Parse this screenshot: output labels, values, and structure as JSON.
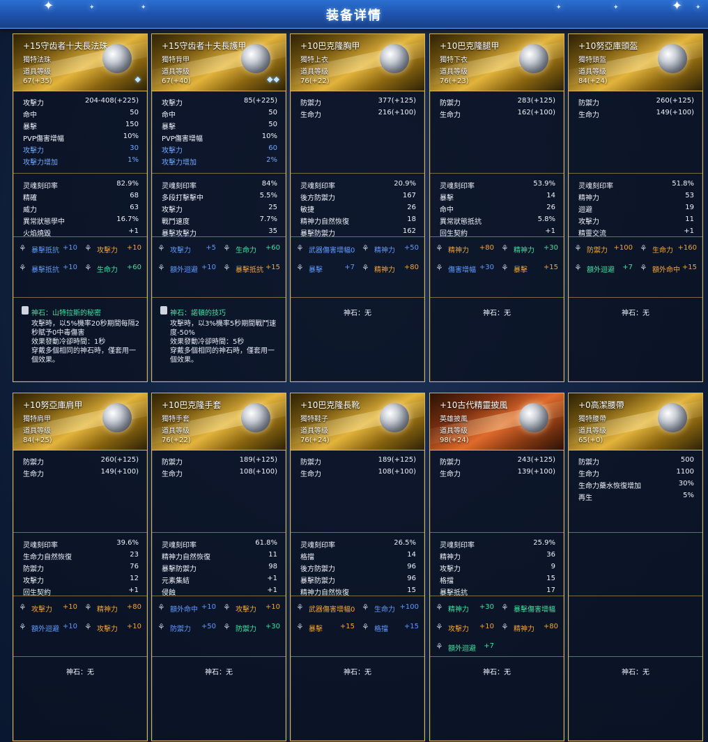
{
  "window": {
    "title": "装备详情"
  },
  "colors": {
    "accent": "#d6b45a",
    "blue": "#5e9bff",
    "orange": "#f5a434",
    "green": "#3fe0a0"
  },
  "items": [
    {
      "name": "+15守齿者十夫長法珠",
      "type": "獨特法珠",
      "level_label": "道具等级",
      "level": "67(+35)",
      "gems": "◆",
      "base": [
        {
          "k": "攻擊力",
          "v": "204-408(+225)",
          "c": ""
        },
        {
          "k": "命中",
          "v": "50",
          "c": ""
        },
        {
          "k": "暴擊",
          "v": "150",
          "c": ""
        },
        {
          "k": "PVP傷害增幅",
          "v": "10%",
          "c": ""
        },
        {
          "k": "攻擊力",
          "v": "30",
          "c": "blue"
        },
        {
          "k": "攻擊力增加",
          "v": "1%",
          "c": "blue"
        }
      ],
      "secondary": [
        {
          "k": "灵魂刻印率",
          "v": "82.9%"
        },
        {
          "k": "精確",
          "v": "68"
        },
        {
          "k": "威力",
          "v": "63"
        },
        {
          "k": "異常狀態學中",
          "v": "16.7%"
        },
        {
          "k": "火焰燒毀",
          "v": "+1"
        }
      ],
      "bonuses": [
        {
          "k": "暴擊抵抗",
          "v": "+10",
          "c": "blue"
        },
        {
          "k": "攻擊力",
          "v": "+10",
          "c": "orange"
        },
        {
          "k": "暴擊抵抗",
          "v": "+10",
          "c": "blue"
        },
        {
          "k": "生命力",
          "v": "+60",
          "c": "green"
        }
      ],
      "stone": "神石：山特拉斯的秘密",
      "stone_desc": "攻擊時，以5%機率20秒期間每隔2秒賦予0中毒傷害\n效果發動冷卻時間：1秒\n穿戴多個相同的神石時，僅套用一個效果。"
    },
    {
      "name": "+15守齿者十夫長護甲",
      "type": "獨特背甲",
      "level_label": "道具等级",
      "level": "67(+40)",
      "gems": "◆◆",
      "base": [
        {
          "k": "攻擊力",
          "v": "85(+225)",
          "c": ""
        },
        {
          "k": "命中",
          "v": "50",
          "c": ""
        },
        {
          "k": "暴擊",
          "v": "50",
          "c": ""
        },
        {
          "k": "PVP傷害增幅",
          "v": "10%",
          "c": ""
        },
        {
          "k": "攻擊力",
          "v": "60",
          "c": "blue"
        },
        {
          "k": "攻擊力增加",
          "v": "2%",
          "c": "blue"
        }
      ],
      "secondary": [
        {
          "k": "灵魂刻印率",
          "v": "84%"
        },
        {
          "k": "多段打擊擊中",
          "v": "5.5%"
        },
        {
          "k": "攻擊力",
          "v": "25"
        },
        {
          "k": "戰鬥速度",
          "v": "7.7%"
        },
        {
          "k": "暴擊攻擊力",
          "v": "35"
        }
      ],
      "bonuses": [
        {
          "k": "攻擊力",
          "v": "+5",
          "c": "blue"
        },
        {
          "k": "生命力",
          "v": "+60",
          "c": "green"
        },
        {
          "k": "額外迴避",
          "v": "+10",
          "c": "blue"
        },
        {
          "k": "暴擊抵抗",
          "v": "+15",
          "c": "orange"
        }
      ],
      "stone": "神石：諾頓的技巧",
      "stone_desc": "攻擊時，以3%機率5秒期間戰鬥速度-50%\n效果發動冷卻時間：5秒\n穿戴多個相同的神石時，僅套用一個效果。"
    },
    {
      "name": "+10巴克隆胸甲",
      "type": "獨特上衣",
      "level_label": "道具等级",
      "level": "76(+22)",
      "gems": "",
      "base": [
        {
          "k": "防禦力",
          "v": "377(+125)",
          "c": ""
        },
        {
          "k": "生命力",
          "v": "216(+100)",
          "c": ""
        }
      ],
      "secondary": [
        {
          "k": "灵魂刻印率",
          "v": "20.9%"
        },
        {
          "k": "後方防禦力",
          "v": "167"
        },
        {
          "k": "敏捷",
          "v": "26"
        },
        {
          "k": "精神力自然恢復",
          "v": "18"
        },
        {
          "k": "暴擊防禦力",
          "v": "162"
        }
      ],
      "bonuses": [
        {
          "k": "武器傷害增幅0",
          "v": "",
          "c": "blue"
        },
        {
          "k": "精神力",
          "v": "+50",
          "c": "blue"
        },
        {
          "k": "暴擊",
          "v": "+7",
          "c": "blue"
        },
        {
          "k": "精神力",
          "v": "+80",
          "c": "orange"
        }
      ],
      "stone": "神石：无",
      "stone_desc": ""
    },
    {
      "name": "+10巴克隆腿甲",
      "type": "獨特下衣",
      "level_label": "道具等级",
      "level": "76(+23)",
      "gems": "",
      "base": [
        {
          "k": "防禦力",
          "v": "283(+125)",
          "c": ""
        },
        {
          "k": "生命力",
          "v": "162(+100)",
          "c": ""
        }
      ],
      "secondary": [
        {
          "k": "灵魂刻印率",
          "v": "53.9%"
        },
        {
          "k": "暴擊",
          "v": "14"
        },
        {
          "k": "命中",
          "v": "26"
        },
        {
          "k": "異常狀態抵抗",
          "v": "5.8%"
        },
        {
          "k": "回生契約",
          "v": "+1"
        }
      ],
      "bonuses": [
        {
          "k": "精神力",
          "v": "+80",
          "c": "orange"
        },
        {
          "k": "精神力",
          "v": "+30",
          "c": "green"
        },
        {
          "k": "傷害增幅",
          "v": "+30",
          "c": "blue"
        },
        {
          "k": "暴擊",
          "v": "+15",
          "c": "orange"
        }
      ],
      "stone": "神石：无",
      "stone_desc": ""
    },
    {
      "name": "+10努亞庫頭盔",
      "type": "獨特頭盔",
      "level_label": "道具等级",
      "level": "84(+24)",
      "gems": "",
      "base": [
        {
          "k": "防禦力",
          "v": "260(+125)",
          "c": ""
        },
        {
          "k": "生命力",
          "v": "149(+100)",
          "c": ""
        }
      ],
      "secondary": [
        {
          "k": "灵魂刻印率",
          "v": "51.8%"
        },
        {
          "k": "精神力",
          "v": "53"
        },
        {
          "k": "迴避",
          "v": "19"
        },
        {
          "k": "攻擊力",
          "v": "11"
        },
        {
          "k": "精靈交流",
          "v": "+1"
        }
      ],
      "bonuses": [
        {
          "k": "防禦力",
          "v": "+100",
          "c": "orange"
        },
        {
          "k": "生命力",
          "v": "+160",
          "c": "orange"
        },
        {
          "k": "額外迴避",
          "v": "+7",
          "c": "green"
        },
        {
          "k": "額外命中",
          "v": "+15",
          "c": "orange"
        }
      ],
      "stone": "神石：无",
      "stone_desc": ""
    },
    {
      "name": "+10努亞庫肩甲",
      "type": "獨特肩甲",
      "level_label": "道具等级",
      "level": "84(+25)",
      "gems": "",
      "base": [
        {
          "k": "防禦力",
          "v": "260(+125)",
          "c": ""
        },
        {
          "k": "生命力",
          "v": "149(+100)",
          "c": ""
        }
      ],
      "secondary": [
        {
          "k": "灵魂刻印率",
          "v": "39.6%"
        },
        {
          "k": "生命力自然恢復",
          "v": "23"
        },
        {
          "k": "防禦力",
          "v": "76"
        },
        {
          "k": "攻擊力",
          "v": "12"
        },
        {
          "k": "回生契約",
          "v": "+1"
        }
      ],
      "bonuses": [
        {
          "k": "攻擊力",
          "v": "+10",
          "c": "orange"
        },
        {
          "k": "精神力",
          "v": "+80",
          "c": "orange"
        },
        {
          "k": "額外迴避",
          "v": "+10",
          "c": "blue"
        },
        {
          "k": "攻擊力",
          "v": "+10",
          "c": "orange"
        }
      ],
      "stone": "神石：无",
      "stone_desc": ""
    },
    {
      "name": "+10巴克隆手套",
      "type": "獨特手套",
      "level_label": "道具等级",
      "level": "76(+22)",
      "gems": "",
      "base": [
        {
          "k": "防禦力",
          "v": "189(+125)",
          "c": ""
        },
        {
          "k": "生命力",
          "v": "108(+100)",
          "c": ""
        }
      ],
      "secondary": [
        {
          "k": "灵魂刻印率",
          "v": "61.8%"
        },
        {
          "k": "精神力自然恢復",
          "v": "11"
        },
        {
          "k": "暴擊防禦力",
          "v": "98"
        },
        {
          "k": "元素集結",
          "v": "+1"
        },
        {
          "k": "侵蝕",
          "v": "+1"
        }
      ],
      "bonuses": [
        {
          "k": "額外命中",
          "v": "+10",
          "c": "blue"
        },
        {
          "k": "攻擊力",
          "v": "+10",
          "c": "orange"
        },
        {
          "k": "防禦力",
          "v": "+50",
          "c": "blue"
        },
        {
          "k": "防禦力",
          "v": "+30",
          "c": "green"
        }
      ],
      "stone": "神石：无",
      "stone_desc": ""
    },
    {
      "name": "+10巴克隆長靴",
      "type": "獨特鞋子",
      "level_label": "道具等级",
      "level": "76(+24)",
      "gems": "",
      "base": [
        {
          "k": "防禦力",
          "v": "189(+125)",
          "c": ""
        },
        {
          "k": "生命力",
          "v": "108(+100)",
          "c": ""
        }
      ],
      "secondary": [
        {
          "k": "灵魂刻印率",
          "v": "26.5%"
        },
        {
          "k": "格擋",
          "v": "14"
        },
        {
          "k": "後方防禦力",
          "v": "96"
        },
        {
          "k": "暴擊防禦力",
          "v": "96"
        },
        {
          "k": "精神力自然恢復",
          "v": "15"
        }
      ],
      "bonuses": [
        {
          "k": "武器傷害增幅0",
          "v": "",
          "c": "orange"
        },
        {
          "k": "生命力",
          "v": "+100",
          "c": "blue"
        },
        {
          "k": "暴擊",
          "v": "+15",
          "c": "orange"
        },
        {
          "k": "格擋",
          "v": "+15",
          "c": "blue"
        }
      ],
      "stone": "神石：无",
      "stone_desc": ""
    },
    {
      "name": "+10古代精靈披風",
      "type": "英雄披風",
      "level_label": "道具等级",
      "level": "98(+24)",
      "gems": "",
      "red": true,
      "base": [
        {
          "k": "防禦力",
          "v": "243(+125)",
          "c": ""
        },
        {
          "k": "生命力",
          "v": "139(+100)",
          "c": ""
        }
      ],
      "secondary": [
        {
          "k": "灵魂刻印率",
          "v": "25.9%"
        },
        {
          "k": "精神力",
          "v": "36"
        },
        {
          "k": "攻擊力",
          "v": "9"
        },
        {
          "k": "格擋",
          "v": "15"
        },
        {
          "k": "暴擊抵抗",
          "v": "17"
        }
      ],
      "bonuses": [
        {
          "k": "精神力",
          "v": "+30",
          "c": "green"
        },
        {
          "k": "暴擊傷害增幅",
          "v": "",
          "c": "green"
        },
        {
          "k": "攻擊力",
          "v": "+10",
          "c": "orange"
        },
        {
          "k": "精神力",
          "v": "+80",
          "c": "orange"
        },
        {
          "k": "額外迴避",
          "v": "+7",
          "c": "green"
        }
      ],
      "stone": "神石：无",
      "stone_desc": ""
    },
    {
      "name": "+0高潔腰帶",
      "type": "獨特腰帶",
      "level_label": "道具等级",
      "level": "65(+0)",
      "gems": "",
      "base": [
        {
          "k": "防禦力",
          "v": "500",
          "c": ""
        },
        {
          "k": "生命力",
          "v": "1100",
          "c": ""
        },
        {
          "k": "生命力藥水恢復增加",
          "v": "30%",
          "c": ""
        },
        {
          "k": "再生",
          "v": "5%",
          "c": ""
        }
      ],
      "secondary": [],
      "bonuses": [],
      "stone": "神石：无",
      "stone_desc": ""
    }
  ]
}
